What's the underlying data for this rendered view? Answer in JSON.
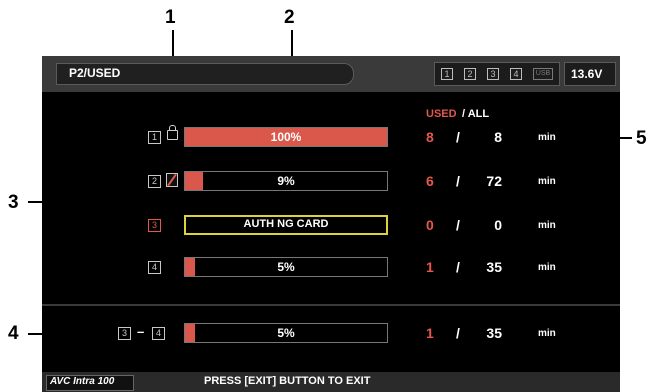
{
  "callouts": [
    "1",
    "2",
    "3",
    "4",
    "5"
  ],
  "header": {
    "title": "P2/USED",
    "slots": [
      "1",
      "2",
      "3",
      "4"
    ],
    "usb": "USB",
    "voltage": "13.6V"
  },
  "columns": {
    "used": "USED",
    "sep": "/ ALL"
  },
  "rows": [
    {
      "slot": "1",
      "bar_text": "100%",
      "fill": 1.0,
      "used": "8",
      "all": "8",
      "unit": "min",
      "icon": "lock-icon"
    },
    {
      "slot": "2",
      "bar_text": "9%",
      "fill": 0.09,
      "used": "6",
      "all": "72",
      "unit": "min",
      "icon": "write-protect-icon"
    },
    {
      "slot": "3",
      "bar_text": "AUTH NG CARD",
      "fill": 0,
      "used": "0",
      "all": "0",
      "unit": "min",
      "icon": ""
    },
    {
      "slot": "4",
      "bar_text": "5%",
      "fill": 0.05,
      "used": "1",
      "all": "35",
      "unit": "min",
      "icon": ""
    }
  ],
  "total": {
    "slot_from": "3",
    "dash": "–",
    "slot_to": "4",
    "bar_text": "5%",
    "fill": 0.05,
    "used": "1",
    "all": "35",
    "unit": "min"
  },
  "footer": {
    "logo": "AVC Intra 100",
    "message": "PRESS [EXIT] BUTTON TO EXIT"
  },
  "colors": {
    "used": "#e2584c",
    "bar_fill": "#d9574b",
    "warn_border": "#ddd23a",
    "background": "#000000"
  }
}
